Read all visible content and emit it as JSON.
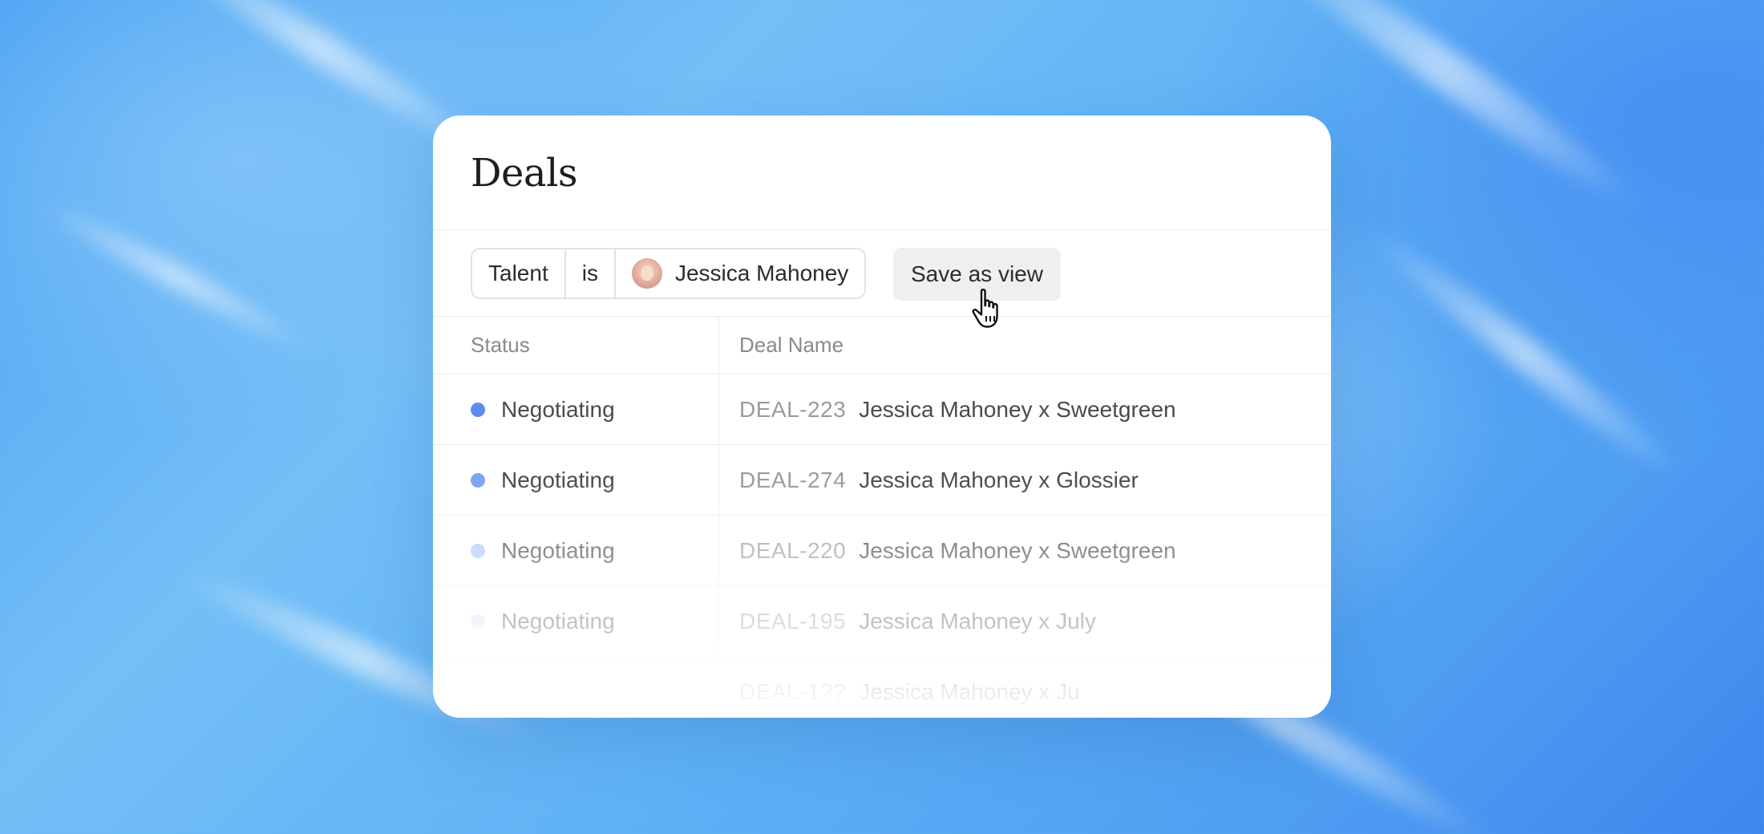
{
  "card": {
    "title": "Deals"
  },
  "filter": {
    "field": "Talent",
    "operator": "is",
    "value": "Jessica Mahoney"
  },
  "save_button": {
    "label": "Save as view"
  },
  "table": {
    "columns": [
      "Status",
      "Deal Name"
    ],
    "rows": [
      {
        "status": "Negotiating",
        "status_color": "#5b8def",
        "deal_id": "DEAL-223",
        "deal_name": "Jessica Mahoney x Sweetgreen"
      },
      {
        "status": "Negotiating",
        "status_color": "#5b8def",
        "deal_id": "DEAL-274",
        "deal_name": "Jessica Mahoney x Glossier"
      },
      {
        "status": "Negotiating",
        "status_color": "#5b8def",
        "deal_id": "DEAL-220",
        "deal_name": "Jessica Mahoney x Sweetgreen"
      },
      {
        "status": "Negotiating",
        "status_color": "#5b8def",
        "deal_id": "DEAL-195",
        "deal_name": "Jessica Mahoney x July"
      },
      {
        "status": "",
        "status_color": "#5b8def",
        "deal_id": "DEAL-1??",
        "deal_name": "Jessica Mahoney x Ju"
      }
    ]
  },
  "colors": {
    "accent": "#5b8def",
    "background_blue": "#4aa2f2"
  },
  "icons": {
    "cursor": "hand-pointer-icon",
    "avatar": "user-avatar"
  }
}
